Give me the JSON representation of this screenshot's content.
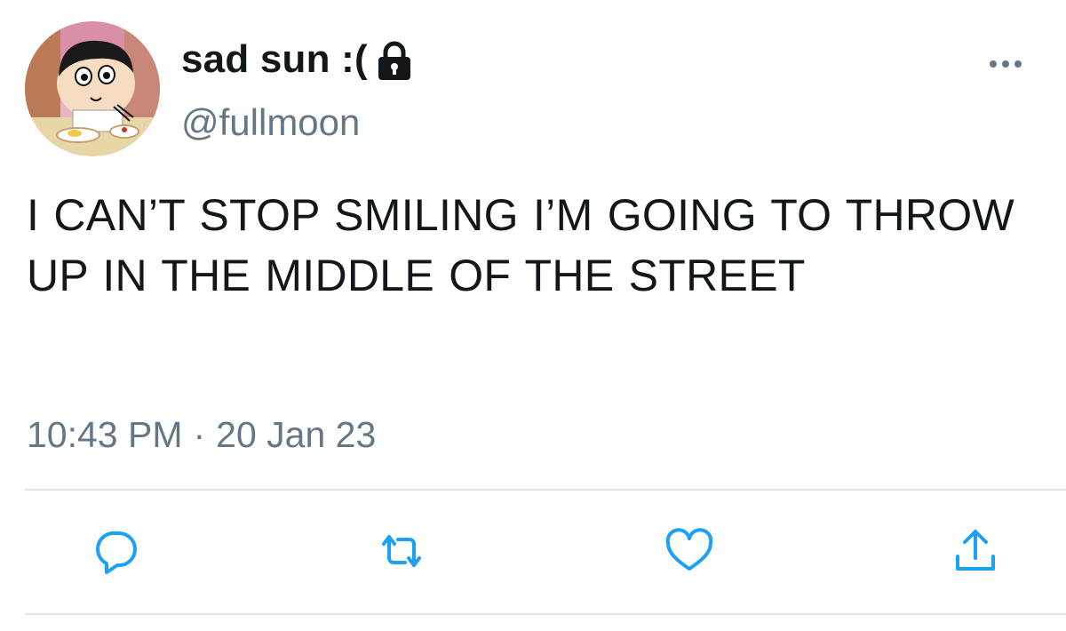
{
  "tweet": {
    "author": {
      "display_name": "sad sun :(",
      "handle": "@fullmoon",
      "protected_icon": "lock-icon",
      "avatar": "cartoon-avatar"
    },
    "more_icon": "more-horizontal-icon",
    "text": "I CAN’T STOP SMILING I’M GOING TO THROW UP IN THE MIDDLE OF THE STREET",
    "time": "10:43 PM",
    "separator": "·",
    "date": "20 Jan 23",
    "actions": [
      {
        "name": "reply",
        "icon": "reply-icon"
      },
      {
        "name": "retweet",
        "icon": "retweet-icon"
      },
      {
        "name": "like",
        "icon": "heart-icon"
      },
      {
        "name": "share",
        "icon": "share-icon"
      }
    ],
    "colors": {
      "text": "#14171a",
      "secondary": "#657786",
      "icon": "#1da1f2",
      "divider": "#e1e8ed"
    }
  }
}
